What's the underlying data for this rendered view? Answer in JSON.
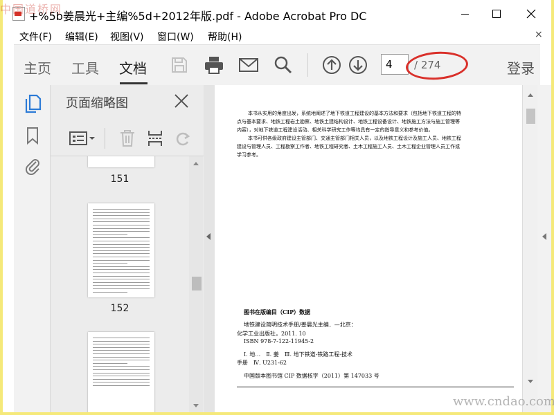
{
  "watermarks": {
    "top": "中国道桥网",
    "bottom": "www.cndao.com"
  },
  "window": {
    "title": "+%5b姜晨光+主编%5d+2012年版.pdf - Adobe Acrobat Pro DC",
    "icons": [
      "pdf-app-icon",
      "minimize-icon",
      "maximize-icon",
      "close-icon"
    ]
  },
  "menu": {
    "items": [
      "文件(F)",
      "编辑(E)",
      "视图(V)",
      "窗口(W)",
      "帮助(H)"
    ],
    "close_glyph": "×"
  },
  "toolbar": {
    "tabs": [
      "主页",
      "工具",
      "文档"
    ],
    "active_tab": "文档",
    "page_current": "4",
    "page_total": "/ 274",
    "login": "登录",
    "highlight_color": "#d9302a",
    "icons": [
      "save-icon",
      "print-icon",
      "email-icon",
      "search-icon",
      "page-up-icon",
      "page-down-icon"
    ]
  },
  "navrail": {
    "icons": [
      "page-thumbnails-icon",
      "bookmark-icon",
      "attachment-icon"
    ],
    "active_color": "#2c7bd6"
  },
  "thumbnails": {
    "title": "页面缩略图",
    "tools": [
      "thumbnail-options-icon",
      "delete-page-icon",
      "insert-page-icon",
      "rotate-page-icon"
    ],
    "pages": [
      {
        "label": "151"
      },
      {
        "label": "152"
      }
    ]
  },
  "document": {
    "paragraph": [
      "本书从实用的角度出发，系统地阐述了地下铁道工程建设的基本方法和要求（包括地下铁道工程的特",
      "点与基本要求、地铁工程岩土勘察、地铁土建结构设计、地铁工程设备设计、地铁施工方法与施工管理等",
      "内容），对地下铁道工程建设活动、相关科学研究工作等均具有一定的指导意义和参考价值。",
      "本书可供各级政府建设主管部门、交通主管部门相关人员，以及地铁工程设计及施工人员、地铁工程",
      "建设与管理人员、工程勘察工作者、地铁工程研究者、土木工程施工人员、土木工程企业管理人员工作或",
      "学习参考。"
    ],
    "cip": {
      "heading": "图书在版编目（CIP）数据",
      "lines": [
        "地铁建设简明技术手册/姜晨光主编．—北京：",
        "化学工业出版社，2011. 10",
        "ISBN 978-7-122-11945-2",
        "Ⅰ. 地…　Ⅱ. 姜　Ⅲ. 地下铁道-铁路工程-技术",
        "手册　Ⅳ. U231-62",
        "中国版本图书馆 CIP 数据核字（2011）第 147033 号"
      ]
    }
  }
}
